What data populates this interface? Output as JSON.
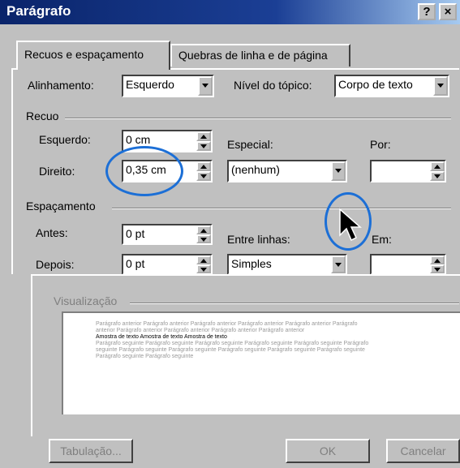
{
  "window": {
    "title": "Parágrafo",
    "help_label": "?",
    "close_label": "×"
  },
  "tabs": [
    {
      "label": "Recuos e espaçamento",
      "active": true
    },
    {
      "label": "Quebras de linha e de página",
      "active": false
    }
  ],
  "general": {
    "alignment_label": "Alinhamento:",
    "alignment_value": "Esquerdo",
    "outline_label": "Nível do tópico:",
    "outline_value": "Corpo de texto"
  },
  "indent": {
    "group_label": "Recuo",
    "left_label": "Esquerdo:",
    "left_value": "0 cm",
    "right_label": "Direito:",
    "right_value": "0,35 cm",
    "special_label": "Especial:",
    "special_value": "(nenhum)",
    "by_label": "Por:",
    "by_value": ""
  },
  "spacing": {
    "group_label": "Espaçamento",
    "before_label": "Antes:",
    "before_value": "0 pt",
    "after_label": "Depois:",
    "after_value": "0 pt",
    "line_label": "Entre linhas:",
    "line_value": "Simples",
    "at_label": "Em:",
    "at_value": ""
  },
  "preview": {
    "label": "Visualização",
    "prev_lines": [
      "Parágrafo anterior Parágrafo anterior Parágrafo anterior Parágrafo anterior Parágrafo anterior Parágrafo",
      "anterior Parágrafo anterior Parágrafo anterior Parágrafo anterior Parágrafo anterior"
    ],
    "current_line": "Amostra de texto Amostra de texto Amostra de texto",
    "next_lines": [
      "Parágrafo seguinte Parágrafo seguinte Parágrafo seguinte Parágrafo seguinte Parágrafo seguinte Parágrafo",
      "seguinte Parágrafo seguinte Parágrafo seguinte Parágrafo seguinte Parágrafo seguinte Parágrafo seguinte",
      "Parágrafo seguinte Parágrafo seguinte"
    ]
  },
  "buttons": {
    "tabs_label": "Tabulação...",
    "ok_label": "OK",
    "cancel_label": "Cancelar"
  },
  "colors": {
    "titlebar": "#0a246a",
    "annotation_circle": "#1c6fd6",
    "face": "#c0c0c0"
  },
  "icons": [
    "help-icon",
    "close-icon",
    "spin-up-icon",
    "spin-down-icon",
    "dropdown-arrow-icon",
    "mouse-pointer-icon"
  ]
}
